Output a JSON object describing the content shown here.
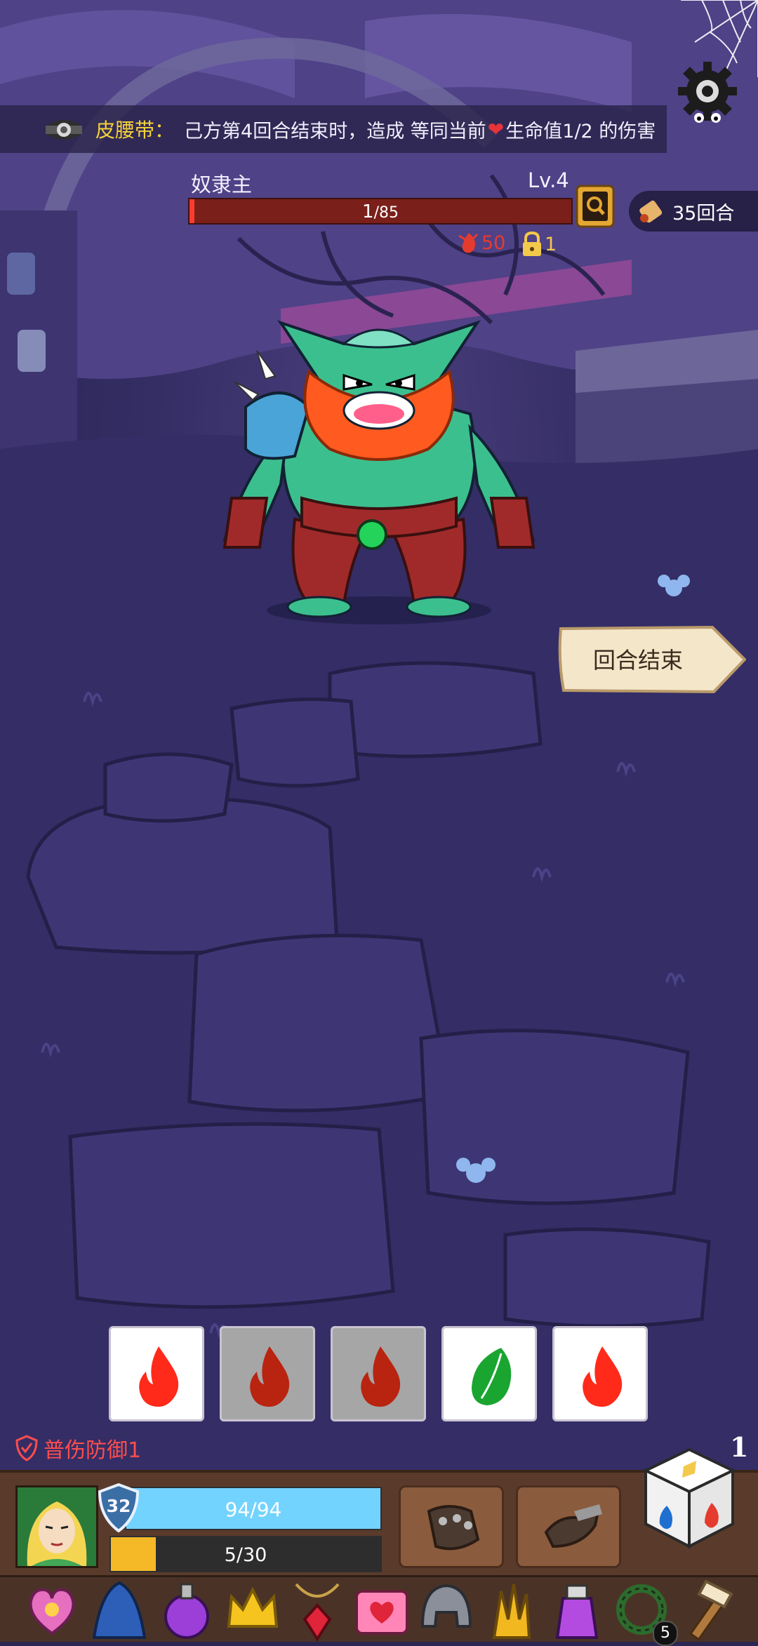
{
  "relic_banner": {
    "relic_name": "皮腰带",
    "colon": "：",
    "desc_before_heart": "己方第4回合结束时，造成 等同当前",
    "heart_glyph": "❤",
    "desc_after_heart": "生命值1/2 的伤害",
    "icon": "belt-icon"
  },
  "enemy": {
    "name": "奴隶主",
    "level": "Lv.4",
    "hp_current": "1",
    "hp_max": "/85",
    "hp_fraction": 0.012,
    "attack": "50",
    "lock": "1",
    "info_icon": "enemy-info-icon"
  },
  "rounds": {
    "label": "35回合",
    "icon": "scroll-icon"
  },
  "end_turn": {
    "label": "回合结束"
  },
  "dice_slots": [
    {
      "face": "fire",
      "state": "active",
      "color": "#ff2a1a"
    },
    {
      "face": "fire",
      "state": "used",
      "color": "#b82410"
    },
    {
      "face": "fire",
      "state": "used",
      "color": "#b82410"
    },
    {
      "face": "leaf",
      "state": "active",
      "color": "#1aa531"
    },
    {
      "face": "fire",
      "state": "active",
      "color": "#ff2a1a"
    }
  ],
  "player": {
    "defense_label": "普伤防御1",
    "level": "32",
    "hp_text": "94/94",
    "hp_fraction": 1.0,
    "energy_text": "5/30",
    "energy_fraction": 0.167,
    "roll_count": "1"
  },
  "skills": [
    {
      "icon": "gauntlet-icon"
    },
    {
      "icon": "smash-icon"
    }
  ],
  "inventory": [
    {
      "icon": "heart-amulet-icon"
    },
    {
      "icon": "blue-cloak-icon"
    },
    {
      "icon": "purple-potion-icon"
    },
    {
      "icon": "crown-icon"
    },
    {
      "icon": "ruby-necklace-icon"
    },
    {
      "icon": "heart-chest-icon"
    },
    {
      "icon": "iron-helmet-icon"
    },
    {
      "icon": "golden-claw-icon"
    },
    {
      "icon": "potion-jar-icon"
    },
    {
      "icon": "thorn-wreath-icon",
      "badge": "5"
    },
    {
      "icon": "hammer-icon"
    }
  ],
  "colors": {
    "accent_gold": "#f5d23a",
    "enemy_hp": "#ff3b2f",
    "player_hp": "#73d3ff",
    "energy": "#f5b928",
    "defense_red": "#ff4d4d"
  }
}
